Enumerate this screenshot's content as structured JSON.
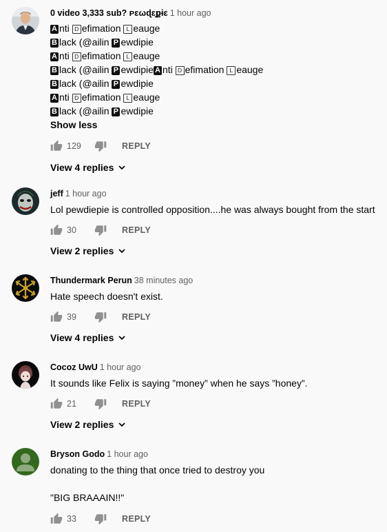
{
  "comments": [
    {
      "author": "0 video 3,333 sub? ᴘɛωɖɛքɨɛ",
      "time": "1 hour ago",
      "lines": [
        [
          [
            "filled",
            "A"
          ],
          [
            "t",
            "nti "
          ],
          [
            "box",
            "D"
          ],
          [
            "t",
            "efimation "
          ],
          [
            "box",
            "L"
          ],
          [
            "t",
            "eauge"
          ]
        ],
        [
          [
            "filled",
            "B"
          ],
          [
            "t",
            "lack (@ailin "
          ],
          [
            "filled",
            "P"
          ],
          [
            "t",
            "ewdipie"
          ]
        ],
        [
          [
            "filled",
            "A"
          ],
          [
            "t",
            "nti "
          ],
          [
            "box",
            "D"
          ],
          [
            "t",
            "efimation "
          ],
          [
            "box",
            "L"
          ],
          [
            "t",
            "eauge"
          ]
        ],
        [
          [
            "filled",
            "B"
          ],
          [
            "t",
            "lack (@ailin "
          ],
          [
            "filled",
            "P"
          ],
          [
            "t",
            "ewdipie"
          ],
          [
            "filled",
            "A"
          ],
          [
            "t",
            "nti "
          ],
          [
            "box",
            "D"
          ],
          [
            "t",
            "efimation "
          ],
          [
            "box",
            "L"
          ],
          [
            "t",
            "eauge"
          ]
        ],
        [
          [
            "filled",
            "B"
          ],
          [
            "t",
            "lack (@ailin "
          ],
          [
            "filled",
            "P"
          ],
          [
            "t",
            "ewdipie"
          ]
        ],
        [
          [
            "filled",
            "A"
          ],
          [
            "t",
            "nti "
          ],
          [
            "box",
            "D"
          ],
          [
            "t",
            "efimation "
          ],
          [
            "box",
            "L"
          ],
          [
            "t",
            "eauge"
          ]
        ],
        [
          [
            "filled",
            "B"
          ],
          [
            "t",
            "lack (@ailin "
          ],
          [
            "filled",
            "P"
          ],
          [
            "t",
            "ewdipie"
          ]
        ]
      ],
      "show_less": "Show less",
      "likes": "129",
      "reply": "REPLY",
      "replies": "View 4 replies"
    },
    {
      "author": "jeff",
      "time": "1 hour ago",
      "text": "Lol pewdiepie is controlled opposition....he was always bought from the start",
      "likes": "30",
      "reply": "REPLY",
      "replies": "View 2 replies"
    },
    {
      "author": "Thundermark Perun",
      "time": "38 minutes ago",
      "text": "Hate speech doesn't exist.",
      "likes": "39",
      "reply": "REPLY",
      "replies": "View 4 replies"
    },
    {
      "author": "Cocoz UwU",
      "time": "1 hour ago",
      "text": "It sounds like Felix is saying ”money” when he says ”honey”.",
      "likes": "21",
      "reply": "REPLY",
      "replies": "View 2 replies"
    },
    {
      "author": "Bryson Godo",
      "time": "1 hour ago",
      "text": "donating to the thing that once tried to destroy you",
      "text2": "\"BIG BRAAAIN!!\"",
      "likes": "33",
      "reply": "REPLY"
    }
  ],
  "icons": {
    "like": "thumb-up-icon",
    "dislike": "thumb-down-icon",
    "expand": "chevron-down-icon"
  },
  "colors": {
    "background": "#f9f9f9",
    "text": "#030303",
    "secondary": "#606060",
    "default_avatar": "#33691e"
  }
}
